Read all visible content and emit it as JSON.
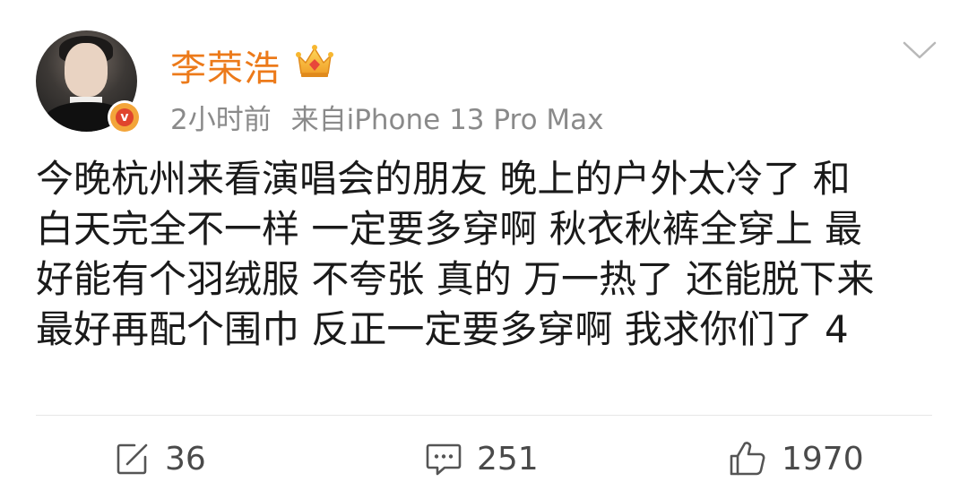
{
  "post_header": {
    "username": "李荣浩",
    "time": "2小时前",
    "source": "来自iPhone 13 Pro Max"
  },
  "post_body": {
    "lines": [
      "今晚杭州来看演唱会的朋友  晚上的户外太冷了 和",
      "白天完全不一样 一定要多穿啊 秋衣秋裤全穿上 最",
      "好能有个羽绒服 不夸张 真的 万一热了 还能脱下来",
      "最好再配个围巾 反正一定要多穿啊 我求你们了 4"
    ]
  },
  "actions": {
    "repost_count": "36",
    "comment_count": "251",
    "like_count": "1970"
  },
  "colors": {
    "username": "#ec7a1a",
    "meta": "#8a8a8a",
    "body_text": "#1a1a1a",
    "action_text": "#4a4a4a"
  },
  "icons": {
    "badge": "verified-badge-icon",
    "crown": "crown-icon",
    "menu": "chevron-down-icon",
    "repost": "repost-icon",
    "comment": "comment-icon",
    "like": "thumbs-up-icon"
  }
}
